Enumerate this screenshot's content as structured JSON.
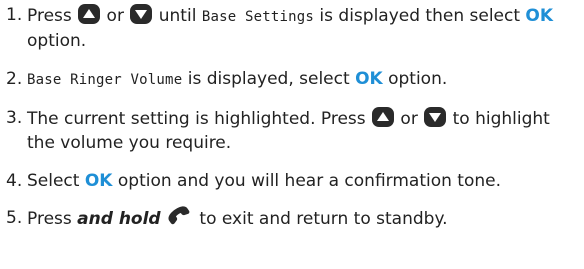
{
  "steps": [
    {
      "number": "1.",
      "segments": [
        {
          "type": "text",
          "value": "Press "
        },
        {
          "type": "icon",
          "name": "up-arrow-key-icon"
        },
        {
          "type": "text",
          "value": " or "
        },
        {
          "type": "icon",
          "name": "down-arrow-key-icon"
        },
        {
          "type": "text",
          "value": " until "
        },
        {
          "type": "lcd",
          "value": "Base Settings"
        },
        {
          "type": "text",
          "value": " is displayed then select "
        },
        {
          "type": "ok",
          "value": "OK"
        },
        {
          "type": "text",
          "value": " option."
        }
      ]
    },
    {
      "number": "2.",
      "segments": [
        {
          "type": "lcd",
          "value": "Base Ringer Volume"
        },
        {
          "type": "text",
          "value": " is displayed, select "
        },
        {
          "type": "ok",
          "value": "OK"
        },
        {
          "type": "text",
          "value": " option."
        }
      ]
    },
    {
      "number": "3.",
      "segments": [
        {
          "type": "text",
          "value": "The current setting is highlighted. Press "
        },
        {
          "type": "icon",
          "name": "up-arrow-key-icon"
        },
        {
          "type": "text",
          "value": " or "
        },
        {
          "type": "icon",
          "name": "down-arrow-key-icon"
        },
        {
          "type": "text",
          "value": " to highlight the volume you require."
        }
      ]
    },
    {
      "number": "4.",
      "segments": [
        {
          "type": "text",
          "value": "Select "
        },
        {
          "type": "ok",
          "value": "OK"
        },
        {
          "type": "text",
          "value": " option and you will hear a confirmation tone."
        }
      ]
    },
    {
      "number": "5.",
      "segments": [
        {
          "type": "text",
          "value": "Press "
        },
        {
          "type": "emph",
          "value": "and hold"
        },
        {
          "type": "text",
          "value": " "
        },
        {
          "type": "icon",
          "name": "end-call-handset-icon"
        },
        {
          "type": "text",
          "value": " to exit and return to standby."
        }
      ]
    }
  ],
  "colors": {
    "text": "#222222",
    "accent": "#1f8fd6",
    "icon": "#2a2a2a"
  }
}
